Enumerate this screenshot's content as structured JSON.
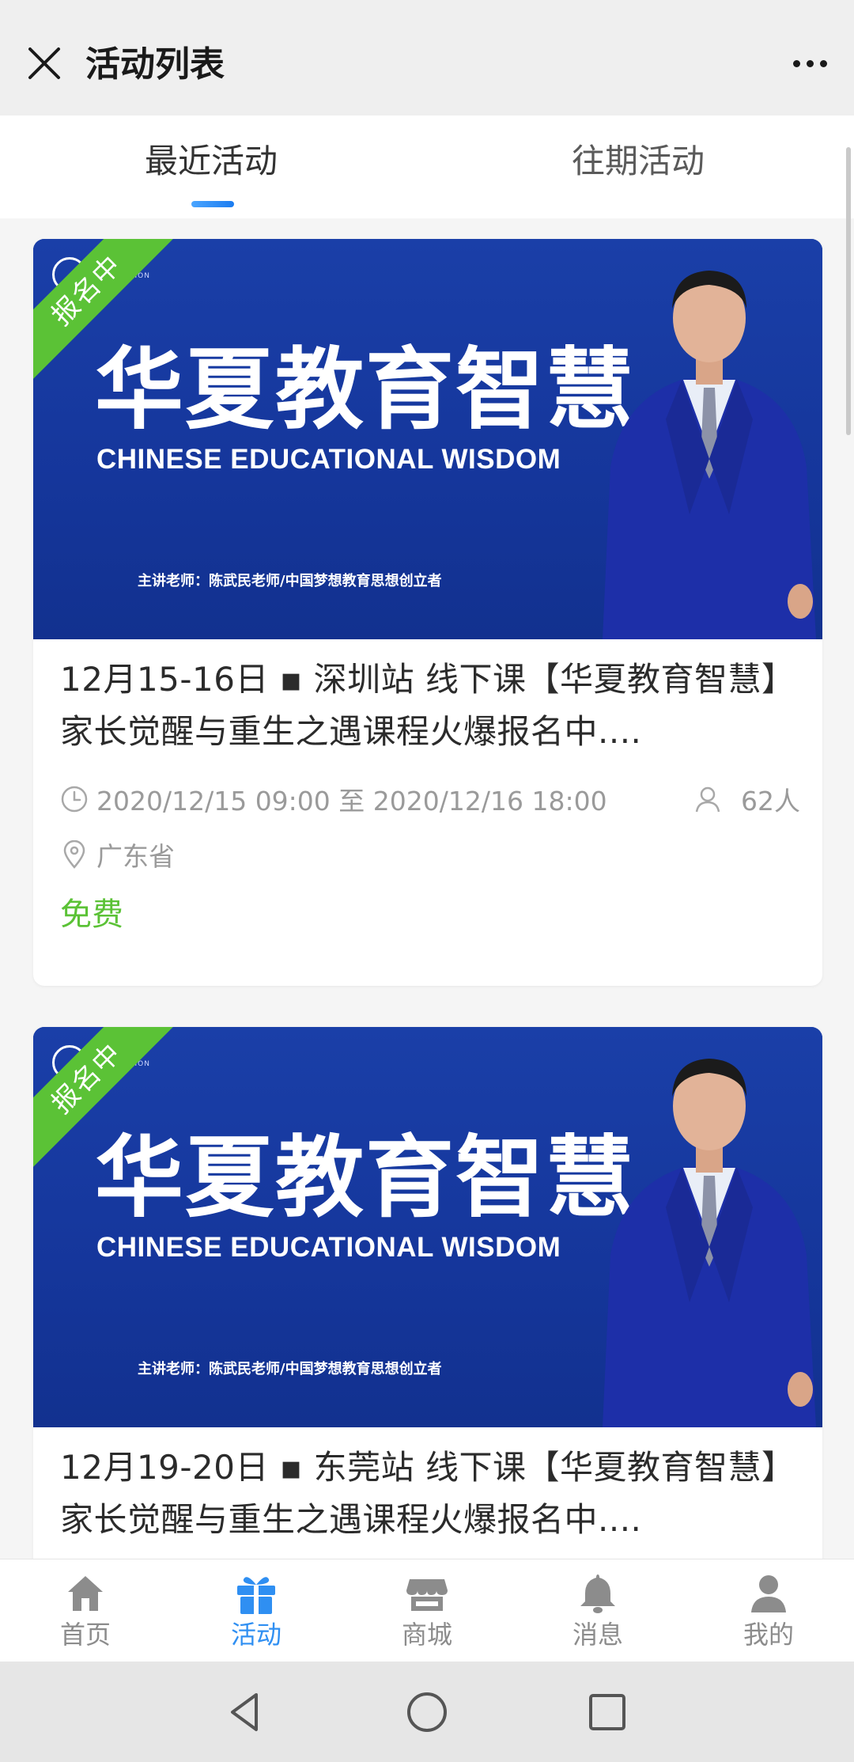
{
  "header": {
    "title": "活动列表"
  },
  "tabs": [
    {
      "label": "最近活动",
      "active": true
    },
    {
      "label": "往期活动",
      "active": false
    }
  ],
  "cards": [
    {
      "ribbon": "报名中",
      "logo_text": "教育",
      "logo_sub": "MIN EDUCATION",
      "banner_title_cn": "华夏教育智慧",
      "banner_title_en": "CHINESE EDUCATIONAL WISDOM",
      "banner_speaker": "主讲老师：陈武民老师/中国梦想教育思想创立者",
      "title": "12月15-16日 ▪ 深圳站 线下课【华夏教育智慧】家长觉醒与重生之遇课程火爆报名中....",
      "time": "2020/12/15 09:00 至 2020/12/16 18:00",
      "count": "62人",
      "location": "广东省",
      "price": "免费"
    },
    {
      "ribbon": "报名中",
      "logo_text": "教育",
      "logo_sub": "MIN EDUCATION",
      "banner_title_cn": "华夏教育智慧",
      "banner_title_en": "CHINESE EDUCATIONAL WISDOM",
      "banner_speaker": "主讲老师：陈武民老师/中国梦想教育思想创立者",
      "title": "12月19-20日 ▪ 东莞站 线下课【华夏教育智慧】家长觉醒与重生之遇课程火爆报名中...."
    }
  ],
  "bottom_nav": [
    {
      "label": "首页",
      "icon": "home-icon",
      "active": false
    },
    {
      "label": "活动",
      "icon": "gift-icon",
      "active": true
    },
    {
      "label": "商城",
      "icon": "store-icon",
      "active": false
    },
    {
      "label": "消息",
      "icon": "bell-icon",
      "active": false
    },
    {
      "label": "我的",
      "icon": "user-icon",
      "active": false
    }
  ],
  "colors": {
    "accent": "#2f8ff2",
    "green": "#5bc236",
    "banner_blue": "#1239a5"
  }
}
